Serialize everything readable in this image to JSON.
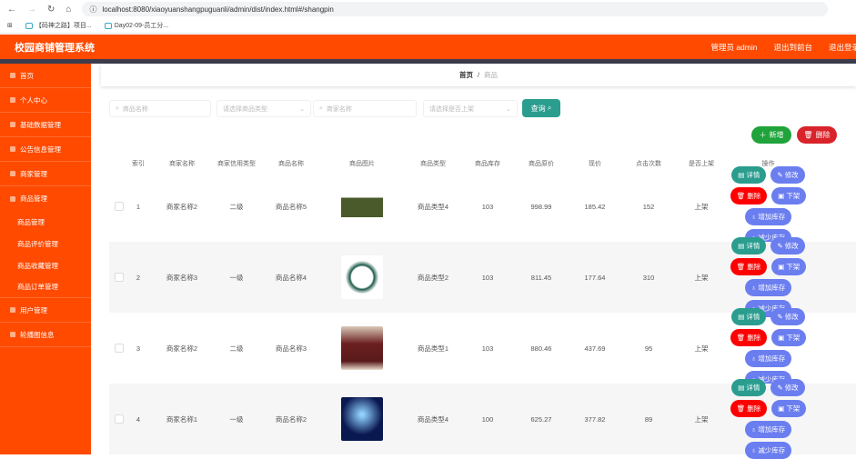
{
  "browser": {
    "url": "localhost:8080/xiaoyuanshangpuguanli/admin/dist/index.html#/shangpin",
    "bookmarks": [
      "【码神之路】项目...",
      "Day02-09-员工分..."
    ]
  },
  "header": {
    "title": "校园商铺管理系统",
    "user": "管理员 admin",
    "to_front": "退出到前台",
    "logout": "退出登录"
  },
  "sidebar": {
    "items": [
      {
        "label": "首页"
      },
      {
        "label": "个人中心"
      },
      {
        "label": "基础数据管理"
      },
      {
        "label": "公告信息管理"
      },
      {
        "label": "商家管理"
      },
      {
        "label": "商品管理"
      }
    ],
    "subitems": [
      "商品管理",
      "商品评价管理",
      "商品收藏管理",
      "商品订单管理"
    ],
    "items2": [
      {
        "label": "用户管理"
      },
      {
        "label": "轮播图信息"
      }
    ]
  },
  "breadcrumb": {
    "home": "首页",
    "current": "商品",
    "sep": "/"
  },
  "search": {
    "name_ph": "商品名称",
    "type_ph": "请选择商品类型",
    "shop_ph": "商家名称",
    "shelf_ph": "请选择是否上架",
    "query": "查询"
  },
  "actions": {
    "add": "新增",
    "delete": "删除"
  },
  "table": {
    "headers": [
      "索引",
      "商家名称",
      "商家信用类型",
      "商品名称",
      "商品图片",
      "商品类型",
      "商品库存",
      "商品原价",
      "现价",
      "点击次数",
      "是否上架",
      "操作"
    ],
    "rows": [
      {
        "index": "1",
        "shop": "商家名称2",
        "credit": "二级",
        "name": "商品名称5",
        "type": "商品类型4",
        "stock": "103",
        "orig": "998.99",
        "price": "185.42",
        "clicks": "152",
        "shelf": "上架"
      },
      {
        "index": "2",
        "shop": "商家名称3",
        "credit": "一级",
        "name": "商品名称4",
        "type": "商品类型2",
        "stock": "103",
        "orig": "811.45",
        "price": "177.64",
        "clicks": "310",
        "shelf": "上架"
      },
      {
        "index": "3",
        "shop": "商家名称2",
        "credit": "二级",
        "name": "商品名称3",
        "type": "商品类型1",
        "stock": "103",
        "orig": "880.46",
        "price": "437.69",
        "clicks": "95",
        "shelf": "上架"
      },
      {
        "index": "4",
        "shop": "商家名称1",
        "credit": "一级",
        "name": "商品名称2",
        "type": "商品类型4",
        "stock": "100",
        "orig": "625.27",
        "price": "377.82",
        "clicks": "89",
        "shelf": "上架"
      }
    ],
    "ops": {
      "detail": "详情",
      "edit": "修改",
      "delete": "删除",
      "off": "下架",
      "add_stock": "增加库存",
      "reduce_stock": "减少库存"
    }
  },
  "colors": {
    "brand": "#ff4a00",
    "teal": "#2a9d8f",
    "blue": "#6b7ef0",
    "red": "#ff0000",
    "green": "#1fa33a"
  }
}
